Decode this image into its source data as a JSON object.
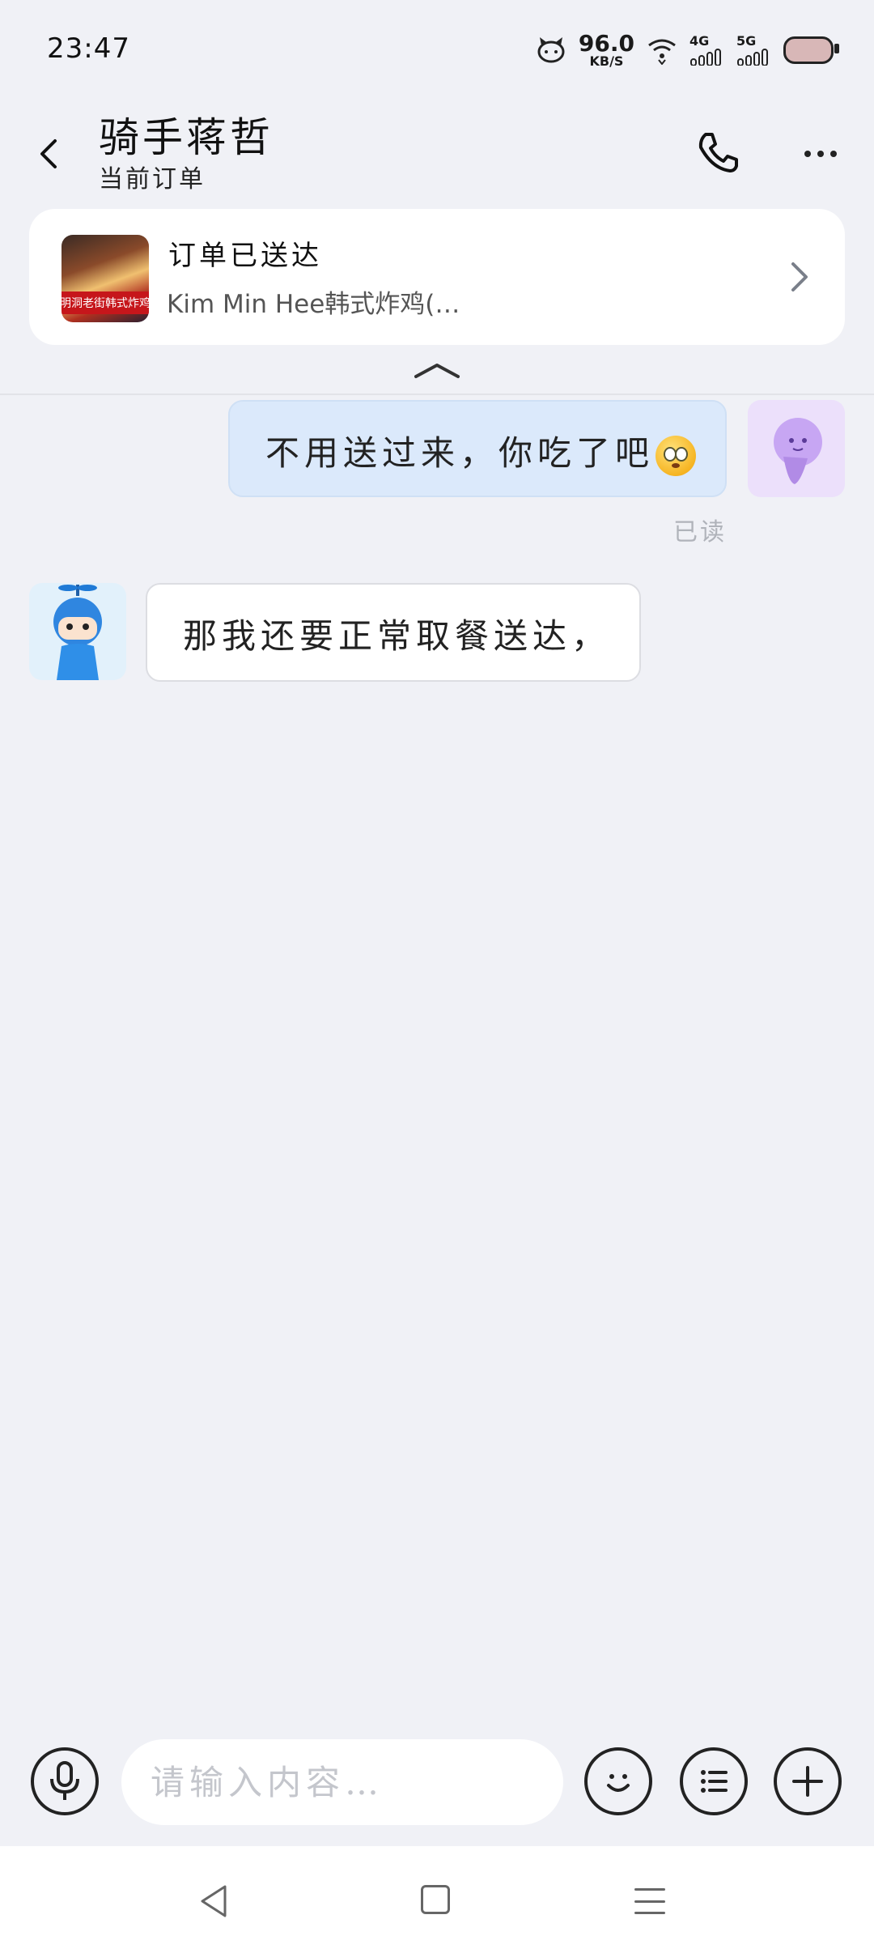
{
  "status_bar": {
    "time": "23:47",
    "net_speed_value": "96.0",
    "net_speed_unit": "KB/S",
    "signal_1_label": "4G",
    "signal_2_label": "5G",
    "icons": [
      "hello-kitty-icon",
      "wifi-icon",
      "signal-icon",
      "signal-icon",
      "battery-icon"
    ]
  },
  "header": {
    "title": "骑手蒋哲",
    "subtitle": "当前订单"
  },
  "order_card": {
    "status": "订单已送达",
    "shop_name": "Kim Min Hee韩式炸鸡(…",
    "thumb_sign": "明洞老街韩式炸鸡"
  },
  "messages": [
    {
      "from": "me",
      "text": "不用送过来，你吃了吧",
      "emoji": "flushed-face",
      "read_status": "已读"
    },
    {
      "from": "rider",
      "text": "那我还要正常取餐送达，"
    }
  ],
  "input": {
    "placeholder": "请输入内容…",
    "value": ""
  },
  "colors": {
    "background": "#f0f1f6",
    "outgoing_bubble": "#dbe9fb",
    "incoming_bubble": "#ffffff",
    "read_text": "#b0b3ba",
    "avatar_me_bg": "#ece0fb",
    "avatar_rider_bg": "#e2f1fb"
  }
}
